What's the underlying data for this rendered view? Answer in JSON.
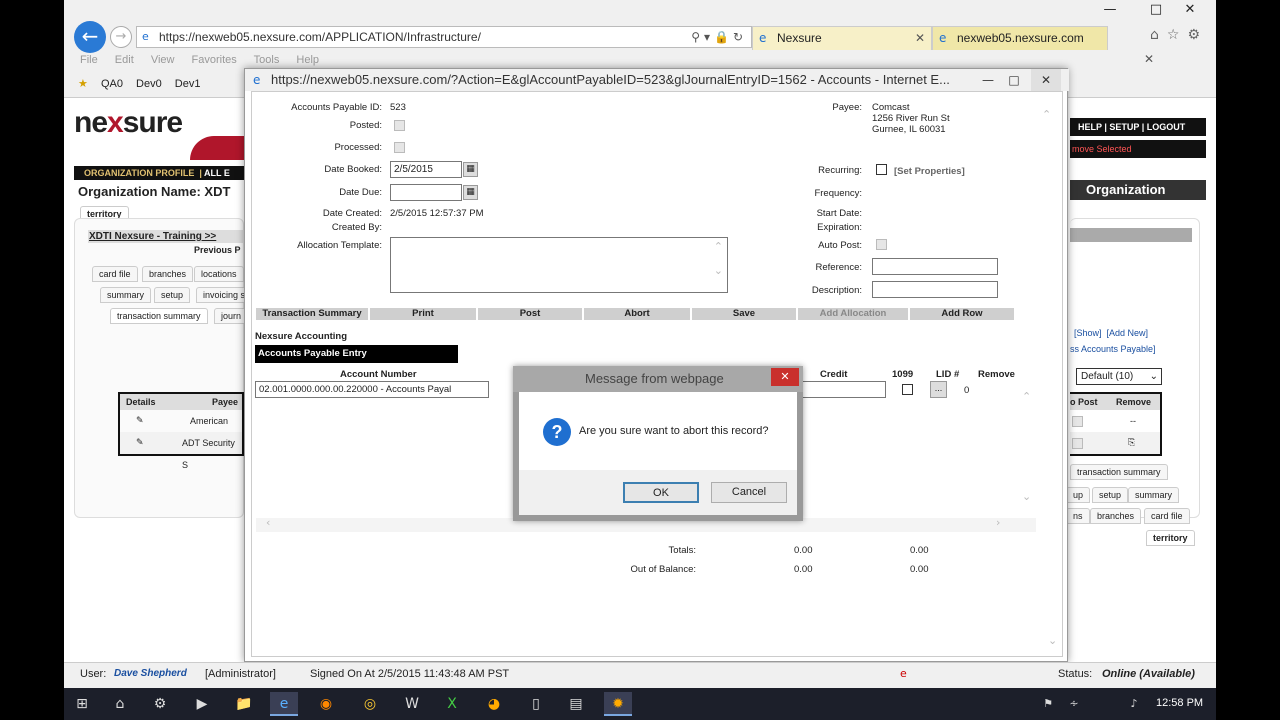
{
  "browser": {
    "url": "https://nexweb05.nexsure.com/APPLICATION/Infrastructure/",
    "tabs": [
      {
        "label": "Nexsure"
      },
      {
        "label": "nexweb05.nexsure.com"
      }
    ],
    "menu": [
      "File",
      "Edit",
      "View",
      "Favorites",
      "Tools",
      "Help"
    ],
    "favorites": [
      "QA0",
      "Dev0",
      "Dev1"
    ]
  },
  "bgpage": {
    "logo": "nexsure",
    "logo_ne": "ne",
    "logo_x": "x",
    "logo_rest": "sure",
    "topnav": "HELP  |  SETUP  |  LOGOUT",
    "remove_selected": "move Selected",
    "orgbar_left": "ORGANIZATION PROFILE",
    "orgbar_right": "ALL E",
    "org_name": "Organization Name: XDT",
    "org_title": "Organization",
    "territory_tab": "territory",
    "breadcrumb": "XDTI Nexsure - Training >>",
    "previous": "Previous P",
    "tabs_row1": [
      "card file",
      "branches",
      "locations"
    ],
    "tabs_row2": [
      "summary",
      "setup",
      "invoicing s"
    ],
    "tabs_row3": [
      "transaction summary",
      "journ"
    ],
    "table_headers": [
      "Details",
      "Payee"
    ],
    "rows": [
      "American Exp",
      "ADT Security S"
    ],
    "right_links": [
      "[Show]",
      "[Add New]"
    ],
    "right_sub": "ss Accounts Payable]",
    "default_select": "Default (10)",
    "right_headers": [
      "o Post",
      "Remove"
    ],
    "right_dash": "--",
    "right_tabs1": [
      "transaction summary"
    ],
    "right_tabs2": [
      "up",
      "setup",
      "summary"
    ],
    "right_tabs3": [
      "ns",
      "branches",
      "card file"
    ],
    "right_territory": "territory"
  },
  "popup": {
    "title": "https://nexweb05.nexsure.com/?Action=E&glAccountPayableID=523&glJournalEntryID=1562 - Accounts - Internet E...",
    "form": {
      "ap_id_label": "Accounts Payable ID:",
      "ap_id": "523",
      "posted_label": "Posted:",
      "processed_label": "Processed:",
      "date_booked_label": "Date Booked:",
      "date_booked": "2/5/2015",
      "date_due_label": "Date Due:",
      "date_due": "",
      "date_created_label": "Date Created:",
      "date_created": "2/5/2015 12:57:37 PM",
      "created_by_label": "Created By:",
      "alloc_template_label": "Allocation Template:",
      "payee_label": "Payee:",
      "payee_name": "Comcast",
      "payee_addr1": "1256 River Run St",
      "payee_addr2": "Gurnee, IL 60031",
      "recurring_label": "Recurring:",
      "set_properties": "[Set Properties]",
      "frequency_label": "Frequency:",
      "start_date_label": "Start Date:",
      "expiration_label": "Expiration:",
      "auto_post_label": "Auto Post:",
      "reference_label": "Reference:",
      "description_label": "Description:"
    },
    "toolbar": [
      "Transaction Summary",
      "Print",
      "Post",
      "Abort",
      "Save",
      "Add Allocation",
      "Add Row"
    ],
    "section_title": "Nexsure Accounting",
    "ap_entry": "Accounts Payable Entry",
    "columns": {
      "account_number": "Account Number",
      "credit": "Credit",
      "c1099": "1099",
      "lid": "LID #",
      "remove": "Remove"
    },
    "row": {
      "account": "02.001.0000.000.00.220000 - Accounts Payal",
      "lid_btn": "...",
      "lid_value": "0"
    },
    "totals_label": "Totals:",
    "totals_debit": "0.00",
    "totals_credit": "0.00",
    "oob_label": "Out of Balance:",
    "oob_debit": "0.00",
    "oob_credit": "0.00"
  },
  "dialog": {
    "title": "Message from webpage",
    "message": "Are you sure want to abort this record?",
    "ok": "OK",
    "cancel": "Cancel"
  },
  "statusbar": {
    "user_label": "User:",
    "user": "Dave Shepherd",
    "role": "[Administrator]",
    "signed_on": "Signed On At  2/5/2015 11:43:48 AM PST",
    "status_label": "Status:",
    "status": "Online (Available)"
  },
  "taskbar": {
    "time": "12:58 PM"
  }
}
